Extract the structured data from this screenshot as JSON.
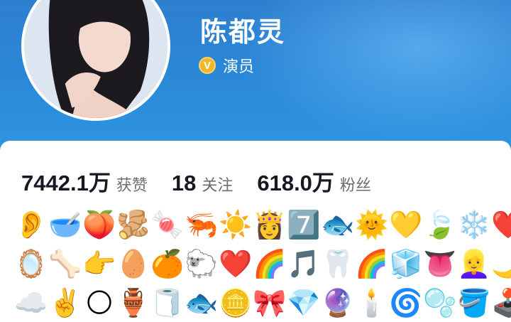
{
  "profile": {
    "name": "陈都灵",
    "role": "演员",
    "verified_badge": "V"
  },
  "stats": [
    {
      "value": "7442.1万",
      "label": "获赞"
    },
    {
      "value": "18",
      "label": "关注"
    },
    {
      "value": "618.0万",
      "label": "粉丝"
    }
  ],
  "emoji_rows": [
    [
      "👂",
      "🥣",
      "🍑",
      "🫚",
      "🍬",
      "🦐",
      "☀️",
      "👸",
      "7️⃣",
      "🐟",
      "🌞",
      "💛",
      "🍃",
      "❄️",
      "❤️"
    ],
    [
      "🪞",
      "🦴",
      "👉",
      "🥚",
      "🍊",
      "🐑",
      "❤️",
      "🌈",
      "🎵",
      "🦷",
      "🌈",
      "🧊",
      "👅",
      "👱‍♀️",
      "🌙"
    ],
    [
      "☁️",
      "✌️",
      "🌕",
      "🏺",
      "🧻",
      "🐟",
      "🪙",
      "🎀",
      "💎",
      "🔮",
      "🕯️",
      "🌀",
      "🫧",
      "🪣",
      "🕹️"
    ]
  ],
  "colors": {
    "header_top": "#2e7fcf",
    "header_bottom": "#2f96e2",
    "badge_gold": "#f1b72b",
    "text_dark": "#161823",
    "text_muted": "#6b6d75"
  }
}
